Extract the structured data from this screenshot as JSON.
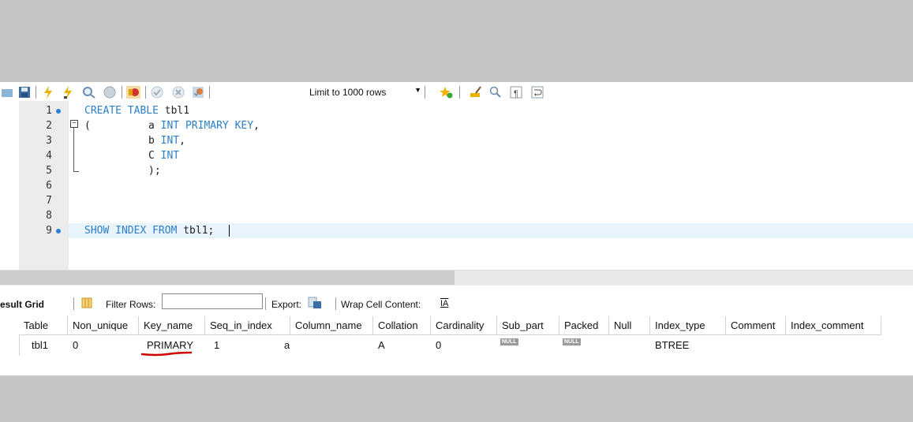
{
  "toolbar": {
    "limit_label": "Limit to 1000 rows",
    "icons": [
      "folder-icon",
      "save-icon",
      "execute-lightning-icon",
      "execute-current-icon",
      "explain-magnifier-icon",
      "stop-icon",
      "toggle-error-icon",
      "commit-icon",
      "rollback-icon",
      "autocommit-icon",
      "beautify-star-icon",
      "brush-icon",
      "find-icon",
      "invisible-chars-icon",
      "word-wrap-icon"
    ]
  },
  "editor": {
    "lines": [
      {
        "n": "1",
        "bp": true
      },
      {
        "n": "2",
        "bp": false
      },
      {
        "n": "3",
        "bp": false
      },
      {
        "n": "4",
        "bp": false
      },
      {
        "n": "5",
        "bp": false
      },
      {
        "n": "6",
        "bp": false
      },
      {
        "n": "7",
        "bp": false
      },
      {
        "n": "8",
        "bp": false
      },
      {
        "n": "9",
        "bp": true
      }
    ],
    "code": {
      "l1_kw": "CREATE TABLE ",
      "l1_id": "tbl1",
      "l2_paren": "(",
      "l2_id": "a ",
      "l2_kw": "INT PRIMARY KEY",
      "l2_end": ",",
      "l3_id": "b ",
      "l3_kw": "INT",
      "l3_end": ",",
      "l4_id": "C ",
      "l4_kw": "INT",
      "l5": ");",
      "l9_kw": "SHOW INDEX FROM ",
      "l9_id": "tbl1;"
    }
  },
  "result_bar": {
    "result_grid": "esult Grid",
    "filter_rows": "Filter Rows:",
    "export": "Export:",
    "wrap": "Wrap Cell Content:",
    "wrap_icon": "IA"
  },
  "grid": {
    "headers": [
      "Table",
      "Non_unique",
      "Key_name",
      "Seq_in_index",
      "Column_name",
      "Collation",
      "Cardinality",
      "Sub_part",
      "Packed",
      "Null",
      "Index_type",
      "Comment",
      "Index_comment"
    ],
    "row": [
      "tbl1",
      "0",
      "PRIMARY",
      "1",
      "a",
      "A",
      "0",
      "NULL",
      "NULL",
      "",
      "BTREE",
      "",
      ""
    ]
  },
  "colors": {
    "keyword": "#2a7fc8",
    "background": "#c6c6c6",
    "annotation": "#cc0000"
  }
}
